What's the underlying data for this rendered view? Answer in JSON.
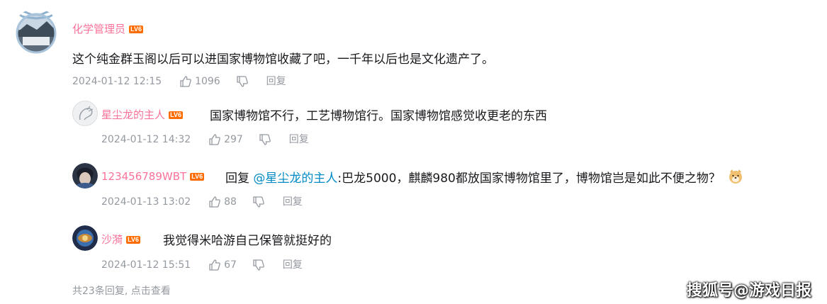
{
  "root_comment": {
    "username": "化学管理员",
    "level": "LV6",
    "content": "这个纯金群玉阁以后可以进国家博物馆收藏了吧，一千年以后也是文化遗产了。",
    "time": "2024-01-12 12:15",
    "likes": "1096",
    "reply_label": "回复"
  },
  "replies": [
    {
      "username": "星尘龙的主人",
      "level": "LV6",
      "content": "国家博物馆不行，工艺博物馆行。国家博物馆感觉收更老的东西",
      "time": "2024-01-12 14:32",
      "likes": "297",
      "reply_label": "回复"
    },
    {
      "username": "123456789WBT",
      "level": "LV6",
      "reply_prefix": "回复",
      "mention": "@星尘龙的主人",
      "content": ":巴龙5000，麒麟980都放国家博物馆里了，博物馆岂是如此不便之物？",
      "time": "2024-01-13 13:02",
      "likes": "88",
      "reply_label": "回复"
    },
    {
      "username": "沙漪",
      "level": "LV6",
      "content": "我觉得米哈游自己保管就挺好的",
      "time": "2024-01-12 15:51",
      "likes": "67",
      "reply_label": "回复"
    }
  ],
  "footer": {
    "view_more": "共23条回复, 点击查看"
  },
  "watermark": "搜狐号@游戏日报",
  "colors": {
    "username": "#fb7299",
    "level_badge": "#ff6c00",
    "mention": "#008ac5",
    "meta": "#9499a0"
  }
}
